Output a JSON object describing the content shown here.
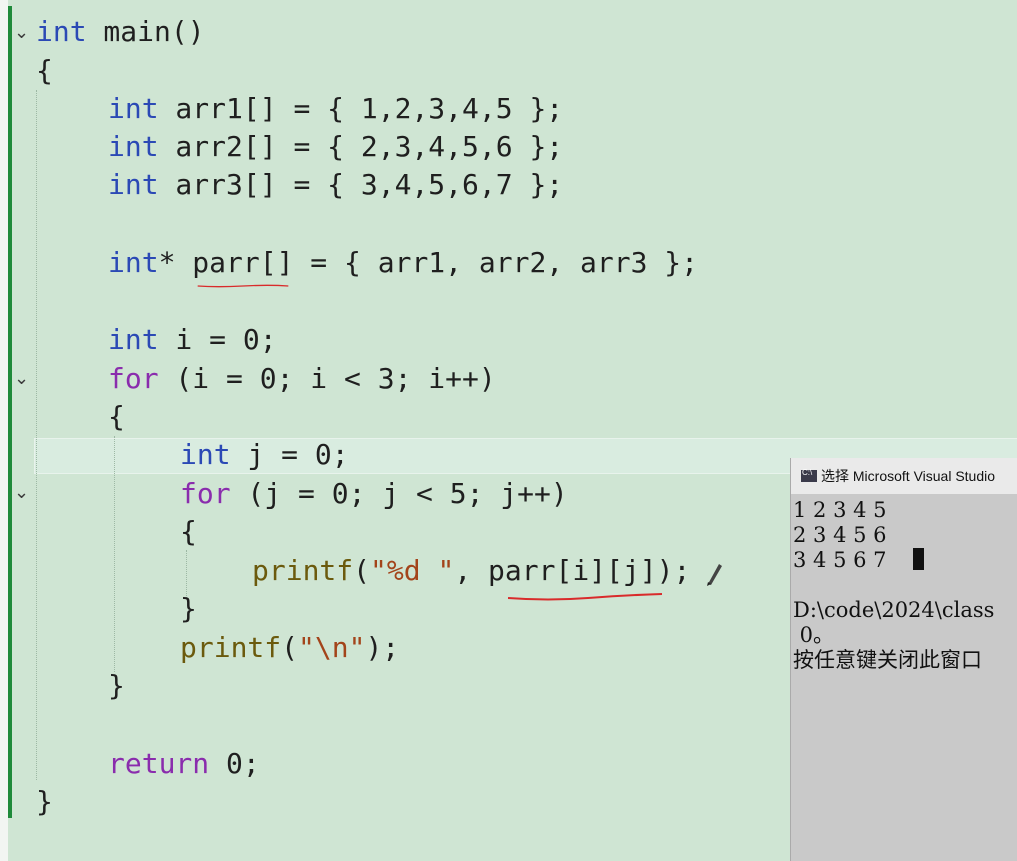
{
  "editor": {
    "lines": {
      "l1": {
        "kw": "int",
        "rest": " main()"
      },
      "l2": "{",
      "l3": {
        "kw": "int",
        "rest": " arr1[] = { 1,2,3,4,5 };"
      },
      "l4": {
        "kw": "int",
        "rest": " arr2[] = { 2,3,4,5,6 };"
      },
      "l5": {
        "kw": "int",
        "rest": " arr3[] = { 3,4,5,6,7 };"
      },
      "l6": {
        "kw": "int",
        "rest": "* parr[] = { arr1, arr2, arr3 };"
      },
      "l7": {
        "kw": "int",
        "rest": " i = 0;"
      },
      "l8": {
        "kw": "for",
        "rest": " (i = 0; i < 3; i++)"
      },
      "l9": "{",
      "l10": {
        "kw": "int",
        "rest": " j = 0;"
      },
      "l11": {
        "kw": "for",
        "rest": " (j = 0; j < 5; j++)"
      },
      "l12": "{",
      "l13": {
        "fn": "printf",
        "open": "(",
        "str": "\"%d \"",
        "rest": ", parr[i][j]);"
      },
      "l14": "}",
      "l15": {
        "fn": "printf",
        "open": "(",
        "str_a": "\"",
        "esc": "\\n",
        "str_b": "\"",
        "rest": ");"
      },
      "l16": "}",
      "l17": {
        "kw": "return",
        "rest": " 0;"
      },
      "l18": "}"
    }
  },
  "console": {
    "title": "选择 Microsoft Visual Studio",
    "output": [
      "1 2 3 4 5",
      "2 3 4 5 6",
      "3 4 5 6 7"
    ],
    "path_line": "D:\\code\\2024\\class",
    "exit_line": " 0。",
    "prompt_line": "按任意键关闭此窗口"
  }
}
